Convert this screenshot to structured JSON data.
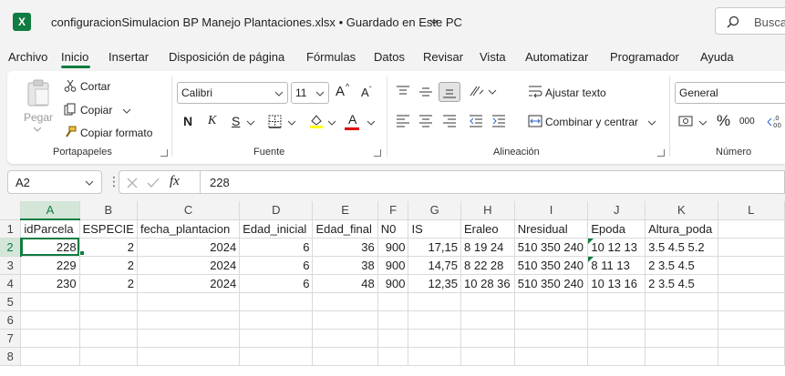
{
  "window": {
    "app_logo": "X",
    "title": "configuracionSimulacion BP Manejo Plantaciones.xlsx",
    "save_status": "Guardado en Este PC",
    "search_placeholder": "Buscar"
  },
  "menu": {
    "tabs": [
      "Archivo",
      "Inicio",
      "Insertar",
      "Disposición de página",
      "Fórmulas",
      "Datos",
      "Revisar",
      "Vista",
      "Automatizar",
      "Programador",
      "Ayuda"
    ],
    "active": "Inicio"
  },
  "ribbon": {
    "clipboard": {
      "label": "Portapapeles",
      "paste": "Pegar",
      "cut": "Cortar",
      "copy": "Copiar",
      "format_painter": "Copiar formato"
    },
    "font": {
      "label": "Fuente",
      "font_name": "Calibri",
      "font_size": "11",
      "grow": "A",
      "shrink": "A",
      "bold": "N",
      "italic": "K",
      "underline": "S",
      "font_color_letter": "A",
      "fill_color": "#ffff00",
      "font_color": "#e00000"
    },
    "alignment": {
      "label": "Alineación",
      "wrap_text": "Ajustar texto",
      "merge_center": "Combinar y centrar"
    },
    "number": {
      "label": "Número",
      "format": "General",
      "percent": "%",
      "thousands": "000"
    }
  },
  "formula_bar": {
    "cell_ref": "A2",
    "fx": "fx",
    "value": "228"
  },
  "sheet": {
    "columns": [
      "A",
      "B",
      "C",
      "D",
      "E",
      "F",
      "G",
      "H",
      "I",
      "J",
      "K",
      "L"
    ],
    "selected_column": "A",
    "selected_row": "2",
    "row_numbers": [
      "1",
      "2",
      "3",
      "4",
      "5",
      "6",
      "7",
      "8"
    ],
    "header_row": [
      "idParcela",
      "ESPECIE",
      "fecha_plantacion",
      "Edad_inicial",
      "Edad_final",
      "N0",
      "IS",
      "Eraleo",
      "Nresidual",
      "Epoda",
      "Altura_poda",
      ""
    ],
    "rows": [
      [
        "228",
        "2",
        "2024",
        "6",
        "36",
        "900",
        "17,15",
        "8 19 24",
        "510 350 240",
        "10 12 13",
        "3.5 4.5 5.2",
        ""
      ],
      [
        "229",
        "2",
        "2024",
        "6",
        "38",
        "900",
        "14,75",
        "8 22 28",
        "510 350 240",
        "8 11 13",
        "2 3.5 4.5",
        ""
      ],
      [
        "230",
        "2",
        "2024",
        "6",
        "48",
        "900",
        "12,35",
        "10 28 36",
        "510 350 240",
        "10 13 16",
        "2 3.5 4.5",
        ""
      ]
    ],
    "accent_color": "#107c41"
  }
}
